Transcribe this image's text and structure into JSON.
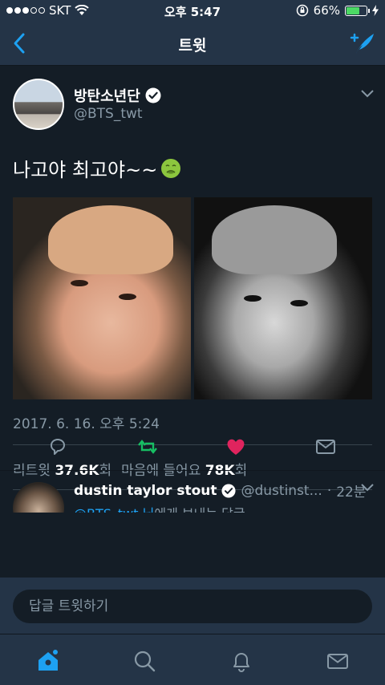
{
  "status_bar": {
    "carrier": "SKT",
    "time": "오후 5:47",
    "battery_percent": "66%",
    "battery_level": 0.66,
    "signal_bars": 3,
    "signal_total": 5
  },
  "nav": {
    "title": "트윗",
    "back_icon": "chevron-left-icon",
    "compose_icon": "compose-feather-icon"
  },
  "tweet": {
    "author_name": "방탄소년단",
    "author_handle": "@BTS_twt",
    "text": "나고야 최고야~~",
    "timestamp": "2017. 6. 16. 오후 5:24",
    "retweet_label": "리트윗",
    "retweet_count": "37.6K",
    "retweet_suffix": "회",
    "like_label": "마음에 들어요",
    "like_count": "78K",
    "like_suffix": "회"
  },
  "reply": {
    "author_name": "dustin taylor stout",
    "author_handle": "@dustinst...",
    "time": "22분",
    "mention": "@BTS_twt 님",
    "text_suffix": "에게 보내는 답글"
  },
  "composer": {
    "placeholder": "답글 트윗하기"
  },
  "colors": {
    "accent": "#1da1f2",
    "retweet": "#17bf63",
    "like": "#e0245e",
    "background": "#141d26",
    "bar": "#243447"
  }
}
